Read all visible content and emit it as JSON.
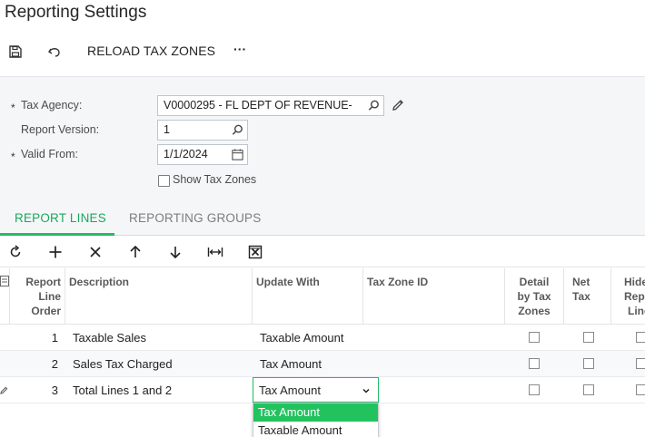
{
  "page": {
    "title": "Reporting Settings"
  },
  "toolbar": {
    "save_icon": "save-icon",
    "undo_icon": "undo-icon",
    "reload_label": "RELOAD TAX ZONES",
    "more_label": "···"
  },
  "form": {
    "tax_agency_label": "Tax Agency:",
    "tax_agency_value": "V0000295 - FL DEPT OF REVENUE-",
    "report_version_label": "Report Version:",
    "report_version_value": "1",
    "valid_from_label": "Valid From:",
    "valid_from_value": "1/1/2024",
    "show_tax_zones_label": "Show Tax Zones",
    "show_tax_zones_checked": false,
    "required_mark": "*"
  },
  "tabs": [
    {
      "label": "REPORT LINES",
      "active": true
    },
    {
      "label": "REPORTING GROUPS",
      "active": false
    }
  ],
  "grid_toolbar": [
    "refresh-icon",
    "add-icon",
    "delete-icon",
    "move-up-icon",
    "move-down-icon",
    "fit-width-icon",
    "excel-export-icon"
  ],
  "grid": {
    "headers": {
      "line_order": [
        "Report",
        "Line",
        "Order"
      ],
      "description": "Description",
      "update_with": "Update With",
      "tax_zone": "Tax Zone ID",
      "detail": [
        "Detail",
        "by Tax",
        "Zones"
      ],
      "net_tax": [
        "Net",
        "Tax"
      ],
      "hide": [
        "Hide",
        "Repo",
        "Line"
      ]
    },
    "rows": [
      {
        "order": "1",
        "description": "Taxable Sales",
        "update_with": "Taxable Amount"
      },
      {
        "order": "2",
        "description": "Sales Tax Charged",
        "update_with": "Tax Amount"
      },
      {
        "order": "3",
        "description": "Total Lines 1 and 2",
        "update_with": "Tax Amount"
      }
    ]
  },
  "dropdown": {
    "value": "Tax Amount",
    "options": [
      "Tax Amount",
      "Taxable Amount"
    ],
    "selected_index": 0
  },
  "colors": {
    "accent": "#1fbd66",
    "selected": "#22c35e"
  }
}
